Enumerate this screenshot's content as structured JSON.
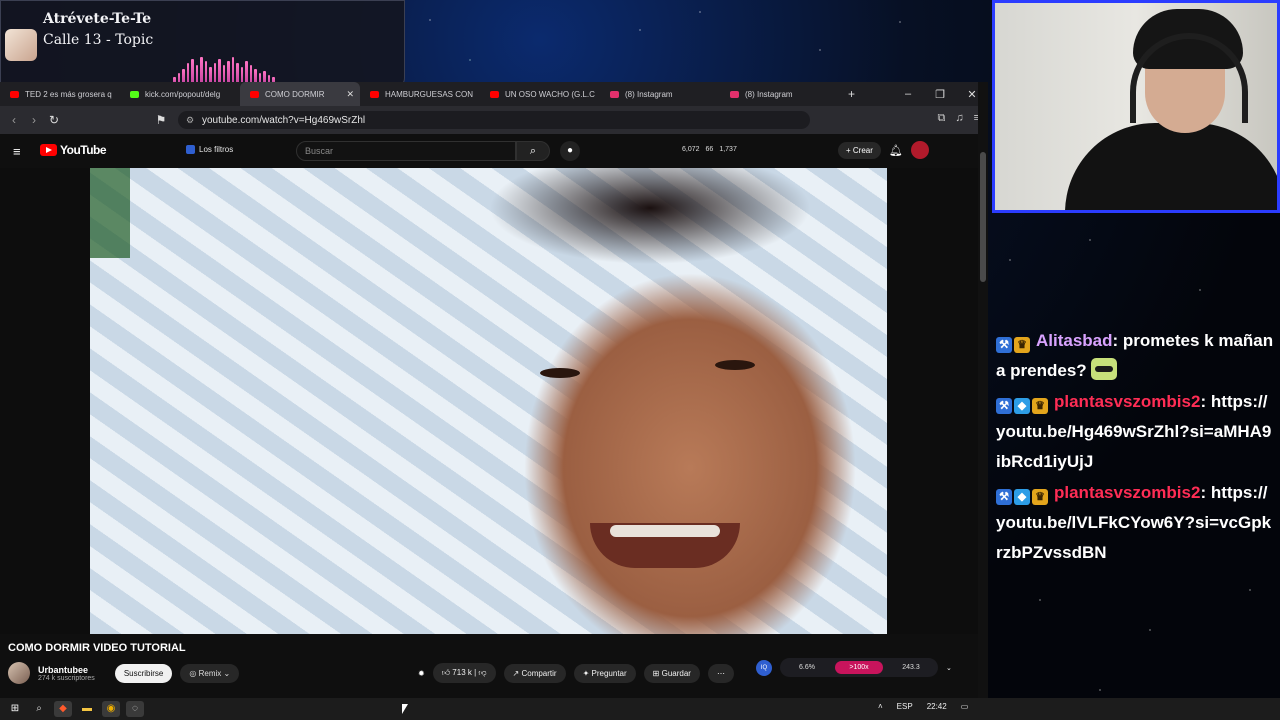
{
  "now_playing": {
    "title": "Atrévete-Te-Te",
    "artist": "Calle 13 - Topic",
    "accent_color": "#ff74c4"
  },
  "browser": {
    "tabs": [
      {
        "label": "TED 2 es más grosera q",
        "icon": "youtube-icon",
        "color": "#ff0000"
      },
      {
        "label": "kick.com/popout/delg",
        "icon": "kick-icon",
        "color": "#53fc18"
      },
      {
        "label": "COMO DORMIR",
        "icon": "youtube-icon",
        "color": "#ff0000",
        "active": true
      },
      {
        "label": "HAMBURGUESAS CON",
        "icon": "youtube-icon",
        "color": "#ff0000"
      },
      {
        "label": "UN OSO WACHO (G.L.C",
        "icon": "youtube-icon",
        "color": "#ff0000"
      },
      {
        "label": "(8) Instagram",
        "icon": "instagram-icon",
        "color": "#e1306c"
      },
      {
        "label": "(8) Instagram",
        "icon": "instagram-icon",
        "color": "#e1306c"
      }
    ],
    "new_tab": "+",
    "window_controls": {
      "minimize": "–",
      "restore": "❐",
      "close": "✕"
    },
    "url": "youtube.com/watch?v=Hg469wSrZhl"
  },
  "youtube": {
    "logo_text": "YouTube",
    "filters_label": "Los filtros",
    "search_placeholder": "Buscar",
    "stats": {
      "views": "6,072",
      "likes": "66",
      "other": "1,737"
    },
    "create_label": "Crear",
    "video_title": "COMO DORMIR VIDEO TUTORIAL",
    "channel_name": "Urbantubee",
    "channel_subs": "274 k suscriptores",
    "subscribe_label": "Suscribirse",
    "remix_label": "Remix",
    "like_count": "713 k",
    "share_label": "Compartir",
    "ask_label": "Preguntar",
    "save_label": "Guardar",
    "ext": {
      "badge": "IQ",
      "a": "6.6%",
      "b": ">100x",
      "c": "243.3"
    }
  },
  "taskbar": {
    "lang": "ESP",
    "time": "22:42"
  },
  "chat": {
    "messages": [
      {
        "user": "Alitasbad",
        "user_color": "#d9a3ff",
        "badges": [
          "b1",
          "b3"
        ],
        "text": ": prometes k mañana prendes?",
        "emote": true
      },
      {
        "user": "plantasvszombis2",
        "user_color": "#ff2d55",
        "badges": [
          "b1",
          "b2",
          "b3"
        ],
        "text": ": https://youtu.be/Hg469wSrZhl?si=aMHA9ibRcd1iyUjJ"
      },
      {
        "user": "plantasvszombis2",
        "user_color": "#ff2d55",
        "badges": [
          "b1",
          "b2",
          "b3"
        ],
        "text": ": https://youtu.be/lVLFkCYow6Y?si=vcGpkrzbPZvssdBN"
      }
    ]
  }
}
